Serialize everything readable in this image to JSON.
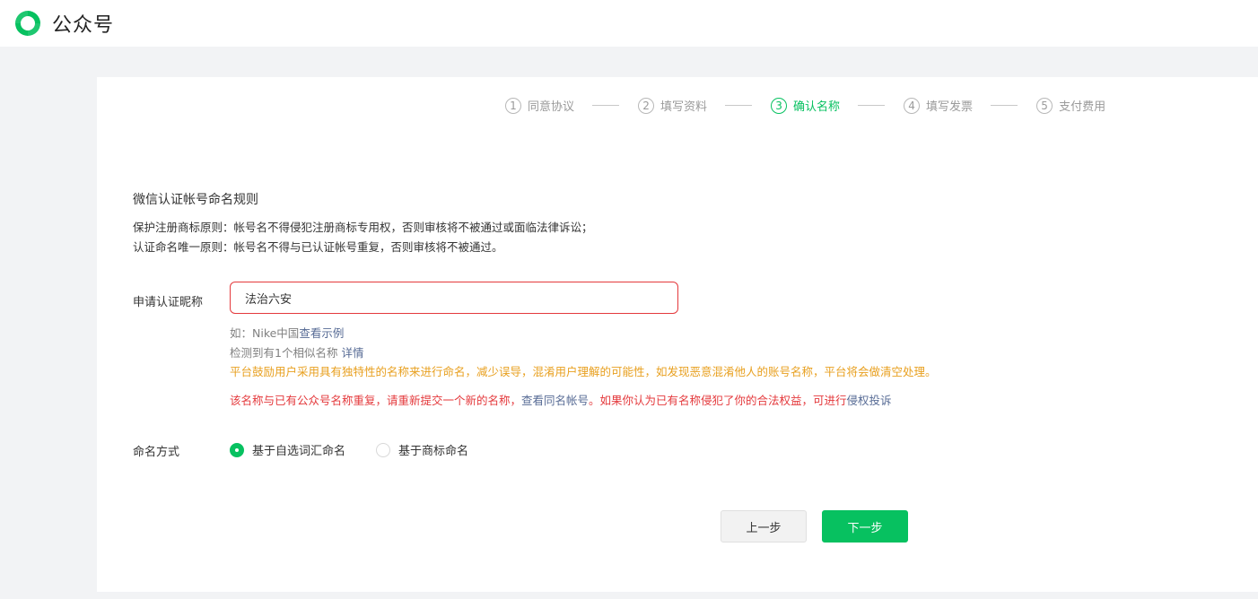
{
  "header": {
    "app_name": "公众号",
    "logo_icon": "wechat-official-account-logo-icon",
    "brand_color": "#07c160"
  },
  "stepper": {
    "steps": [
      {
        "num": "1",
        "label": "同意协议",
        "active": false
      },
      {
        "num": "2",
        "label": "填写资料",
        "active": false
      },
      {
        "num": "3",
        "label": "确认名称",
        "active": true
      },
      {
        "num": "4",
        "label": "填写发票",
        "active": false
      },
      {
        "num": "5",
        "label": "支付费用",
        "active": false
      }
    ]
  },
  "rules": {
    "title": "微信认证帐号命名规则",
    "line1": "保护注册商标原则：帐号名不得侵犯注册商标专用权，否则审核将不被通过或面临法律诉讼；",
    "line2": "认证命名唯一原则：帐号名不得与已认证帐号重复，否则审核将不被通过。"
  },
  "form": {
    "nickname_label": "申请认证昵称",
    "nickname_value": "法治六安",
    "example_prefix": "如：Nike中国",
    "example_link": "查看示例",
    "similar_text": "检测到有1个相似名称",
    "similar_link": "详情",
    "warning_text": "平台鼓励用户采用具有独特性的名称来进行命名，减少误导，混淆用户理解的可能性，如发现恶意混淆他人的账号名称，平台将会做清空处理。",
    "error_text_1": "该名称与已有公众号名称重复，请重新提交一个新的名称，",
    "error_link_1": "查看同名帐号",
    "error_text_2": "。如果你认为已有名称侵犯了你的合法权益，可进行",
    "error_link_2": "侵权投诉",
    "method_label": "命名方式",
    "method_options": [
      {
        "label": "基于自选词汇命名",
        "checked": true
      },
      {
        "label": "基于商标命名",
        "checked": false
      }
    ]
  },
  "actions": {
    "prev_label": "上一步",
    "next_label": "下一步"
  },
  "colors": {
    "accent": "#07c160",
    "error": "#e4393c",
    "warning": "#e8a020",
    "link": "#576b95"
  }
}
